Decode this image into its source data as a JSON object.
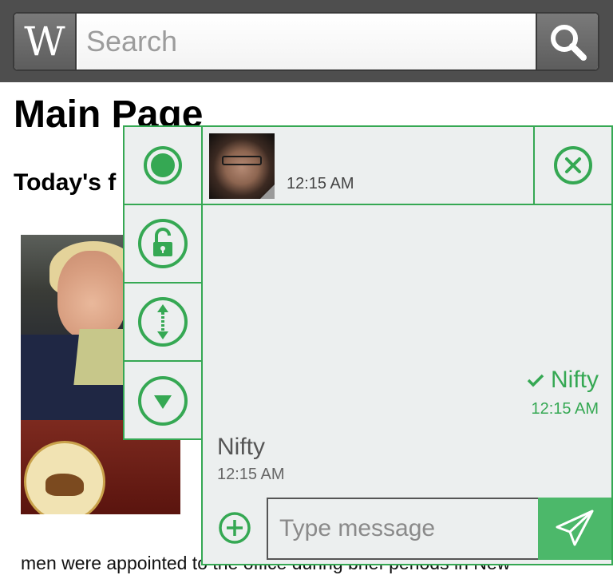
{
  "search": {
    "logo_letter": "W",
    "placeholder": "Search"
  },
  "page": {
    "title": "Main Page",
    "featured_heading": "Today's f",
    "bottom_text": "men were appointed to the office during brief periods in New"
  },
  "chat": {
    "header_time": "12:15 AM",
    "messages": [
      {
        "direction": "outgoing",
        "text": "Nifty",
        "time": "12:15 AM",
        "status": "check-icon"
      },
      {
        "direction": "incoming",
        "text": "Nifty",
        "time": "12:15 AM"
      }
    ],
    "compose_placeholder": "Type message"
  },
  "colors": {
    "accent": "#35a853",
    "send_button": "#4cb86a",
    "panel_bg": "#ecefef",
    "topbar_bg": "#4e4e4e"
  },
  "icons": {
    "toolbar": [
      "status-dot-icon",
      "unlock-icon",
      "resize-vertical-icon",
      "collapse-down-icon"
    ],
    "header": [
      "close-icon"
    ],
    "compose": [
      "add-attachment-icon",
      "send-icon"
    ]
  }
}
